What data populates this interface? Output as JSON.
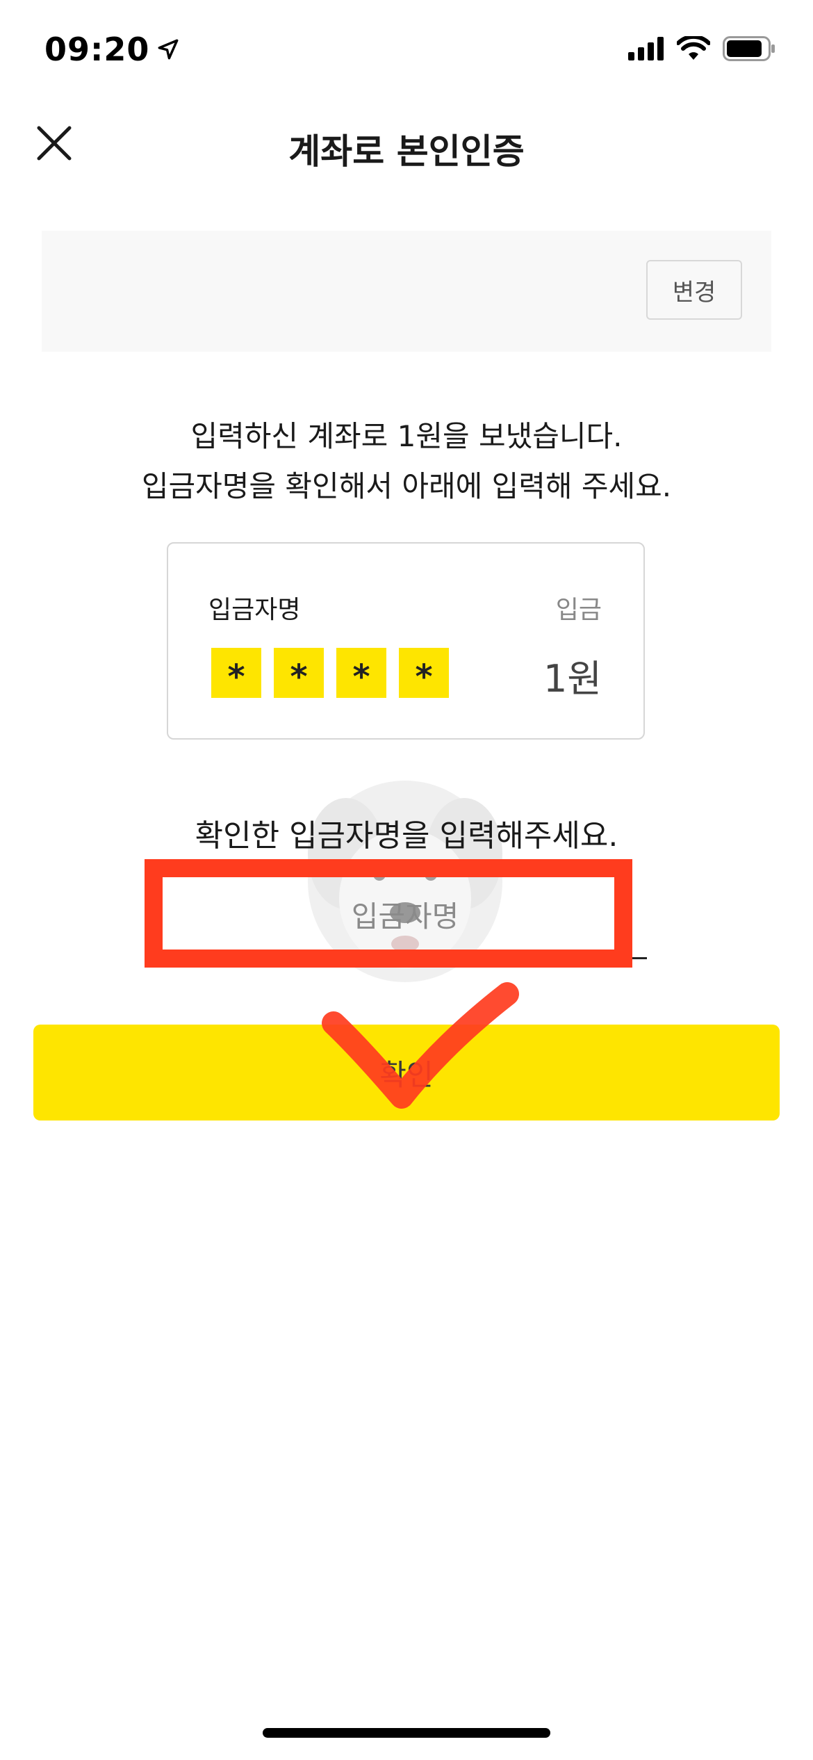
{
  "status_bar": {
    "time": "09:20"
  },
  "nav": {
    "title": "계좌로 본인인증"
  },
  "account_box": {
    "change_label": "변경"
  },
  "instruction": {
    "line1": "입력하신 계좌로 1원을 보냈습니다.",
    "line2": "입금자명을 확인해서 아래에 입력해 주세요."
  },
  "deposit_card": {
    "depositor_label": "입금자명",
    "deposit_label": "입금",
    "masked_chars": [
      "*",
      "*",
      "*",
      "*"
    ],
    "amount": "1원"
  },
  "prompt": "확인한 입금자명을 입력해주세요.",
  "input": {
    "placeholder": "입금자명",
    "value": ""
  },
  "confirm_label": "확인",
  "colors": {
    "accent_yellow": "#fee500",
    "annotation_red": "#ff3c1e"
  }
}
